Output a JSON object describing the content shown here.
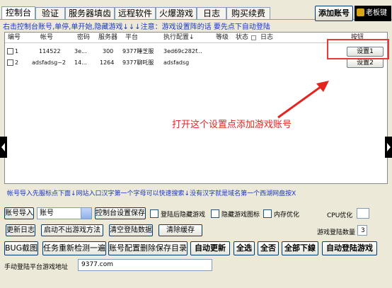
{
  "tabs": [
    "控制台",
    "验证",
    "服务器填齿",
    "远程软件",
    "火爆游戏",
    "日志",
    "购买续费"
  ],
  "toolbar": {
    "add_account_label": "添加账号",
    "logo_text": "老板键"
  },
  "hint_top": "右击控制台账号,单停,单开始,隐藏游戏↓↓↓注意：游戏设置阵的话 要先点下自动登陆",
  "grid": {
    "headers": [
      "编号",
      "帐号",
      "密码",
      "服务器",
      "平台",
      "执行配置↓",
      "等级",
      "状态",
      "日志",
      "按钮"
    ],
    "rows": [
      {
        "no": "1",
        "account": "114522",
        "password": "3e...",
        "server": "300",
        "platform": "9377睡芝服",
        "config": "3ed69c282f...",
        "level": "",
        "status": "",
        "log": "",
        "button": "设置1"
      },
      {
        "no": "2",
        "account": "adsfadsg~2",
        "password": "14...",
        "server": "1264",
        "platform": "9377聊吒服",
        "config": "adsfadsg",
        "level": "",
        "status": "",
        "log": "",
        "button": "设置2"
      }
    ]
  },
  "annotation": "打开这个设置点添加游戏账号",
  "hint_bottom": "帐号导入先服标点下面↓网站入口汉字第一个字母可以快速搜索↓没有汉字就是域名第一个西湖网盘按X",
  "controls": {
    "import_label": "账号导入",
    "account_type_select": "账号",
    "console_save_label": "控制台设置保存",
    "hide_after_login": "登陆后隐藏游戏",
    "hide_game_icon": "隐藏游戏图标",
    "memory_opt": "内存优化",
    "cpu_opt_label": "CPU优化",
    "cpu_opt_value": "",
    "update_log": "更新日志",
    "startup_failure": "启动不出游戏方法",
    "clear_login_data": "清空登陆数据",
    "clear_cache": "清除缓存",
    "login_count_label": "游戏登陆数量",
    "login_count_value": "3",
    "bug_screenshot": "BUG截图",
    "task_recheck": "任务重新检测一遍",
    "delete_saved_dir": "账号配置删除保存目录",
    "auto_update": "自动更新",
    "select_all": "全选",
    "deselect_all": "全否",
    "all_download": "全部下線",
    "auto_login": "自动登陆游戏",
    "manual_platform_label": "手动登陆平台游戏地址",
    "manual_platform_value": "9377.com"
  },
  "colors": {
    "hint_blue": "#1a37c8",
    "annotation_red": "#e5241f"
  }
}
